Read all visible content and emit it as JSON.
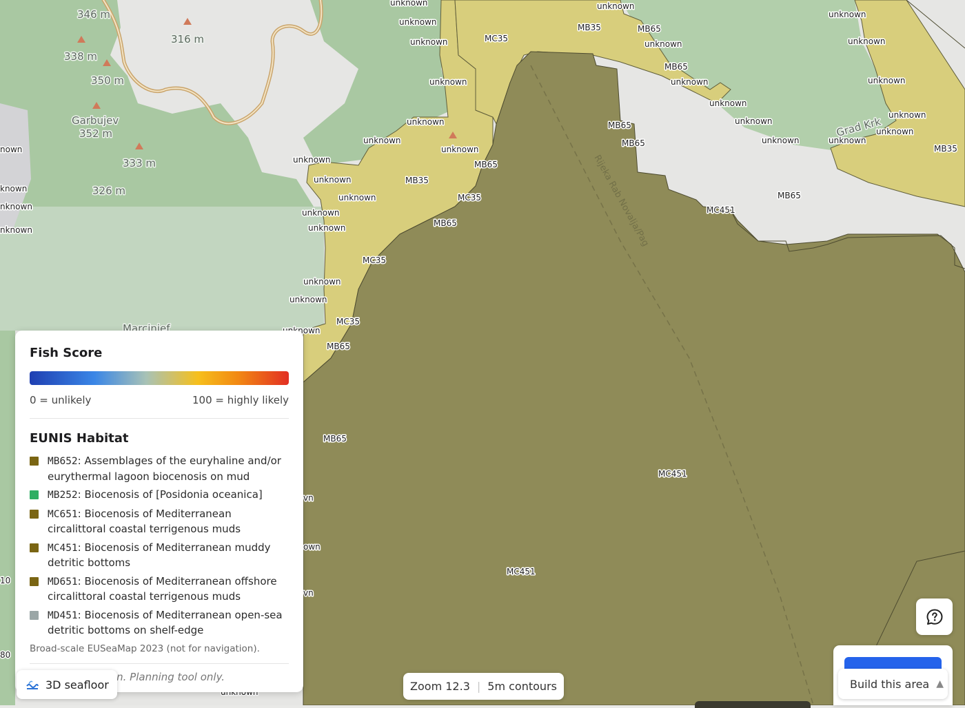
{
  "map": {
    "terrain_labels": {
      "e346": "346 m",
      "e316": "316 m",
      "e338": "338 m",
      "e350": "350 m",
      "garbujev": "Garbujev",
      "e352": "352 m",
      "e333": "333 m",
      "e326": "326 m",
      "marcinjef": "Marcinjef",
      "grad_krk": "Grad Krk",
      "route": "Rijeka Rab  Novalja/Pag"
    },
    "left_edge_labels": [
      "nown",
      "known",
      "nknown",
      "nknown",
      "10",
      "80"
    ],
    "unknown_label": "unknown",
    "habitat_labels": {
      "mc35": "MC35",
      "mb35": "MB35",
      "mb65": "MB65",
      "mc451": "MC451"
    },
    "covered_label_fragments": [
      "vn",
      "own",
      "vn"
    ]
  },
  "colors": {
    "sea_dark": "#8f8b58",
    "shallow_yellow": "#d8ce7c",
    "land_grey": "#e6e6e4",
    "forest_green": "#a9c8a2",
    "accent_blue": "#2463eb"
  },
  "legend": {
    "fish_score_title": "Fish Score",
    "scale_min": "0 = unlikely",
    "scale_max": "100 = highly likely",
    "habitat_title": "EUNIS Habitat",
    "habitats": [
      {
        "code": "MB652",
        "desc": "Assemblages of the euryhaline and/or eurythermal lagoon biocenosis on mud",
        "color": "#7a6513"
      },
      {
        "code": "MB252",
        "desc": "Biocenosis of [Posidonia oceanica]",
        "color": "#2fae63"
      },
      {
        "code": "MC651",
        "desc": "Biocenosis of Mediterranean circalittoral coastal terrigenous muds",
        "color": "#7a6513"
      },
      {
        "code": "MC451",
        "desc": "Biocenosis of Mediterranean muddy detritic bottoms",
        "color": "#7a6513"
      },
      {
        "code": "MD651",
        "desc": "Biocenosis of Mediterranean offshore circalittoral coastal terrigenous muds",
        "color": "#7a6513"
      },
      {
        "code": "MD451",
        "desc": "Biocenosis of Mediterranean open-sea detritic bottoms on shelf-edge",
        "color": "#9aa6a6"
      }
    ],
    "source": "Broad-scale EUSeaMap 2023 (not for navigation).",
    "disclaimer": "Not for navigation. Planning tool only."
  },
  "controls": {
    "seafloor_label": "3D seafloor",
    "seafloor_icon": "wave-icon",
    "zoom_text": "Zoom 12.3",
    "contours_text": "5m contours",
    "feedback_icon": "chat-question-icon",
    "build_label": "Build this area",
    "build_icon": "chevron-up-icon"
  }
}
